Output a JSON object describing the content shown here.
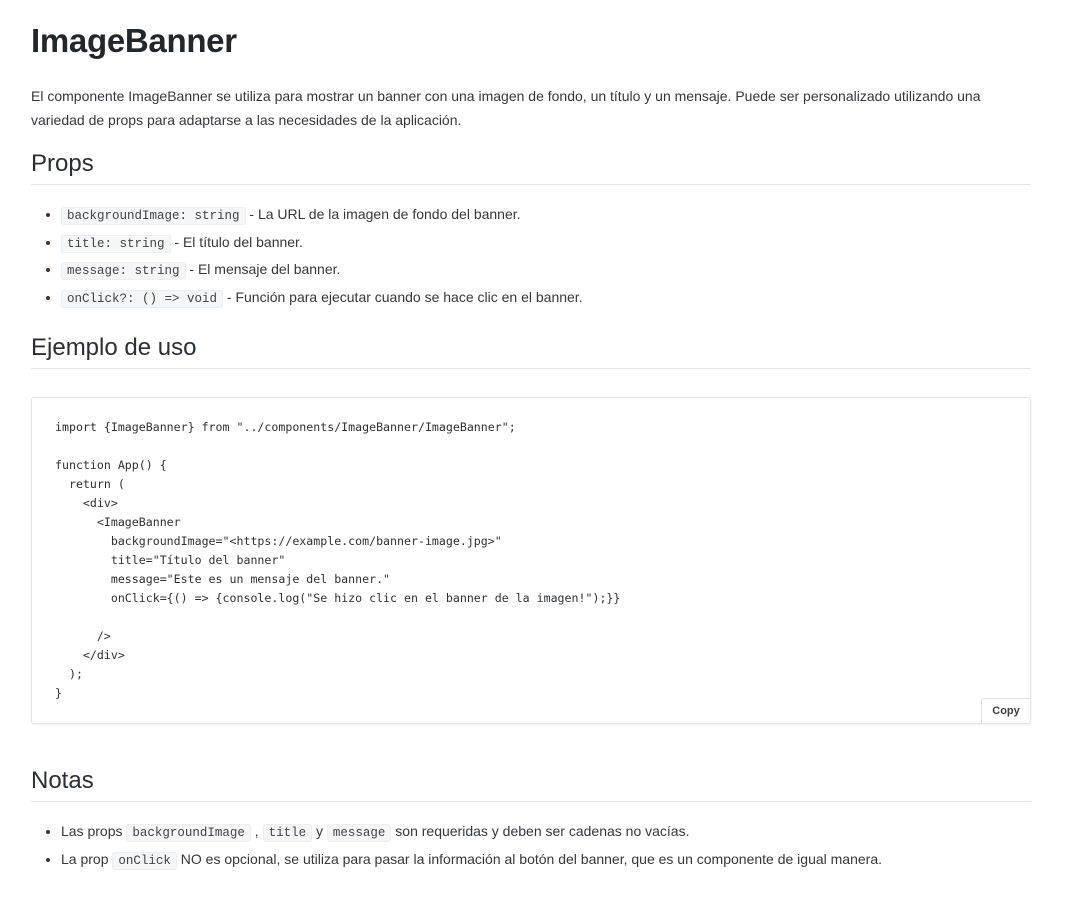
{
  "page": {
    "title": "ImageBanner",
    "intro": "El componente ImageBanner se utiliza para mostrar un banner con una imagen de fondo, un título y un mensaje. Puede ser personalizado utilizando una variedad de props para adaptarse a las necesidades de la aplicación."
  },
  "props_section": {
    "heading": "Props",
    "items": [
      {
        "code": "backgroundImage: string",
        "text": " - La URL de la imagen de fondo del banner."
      },
      {
        "code": "title: string",
        "text": " - El título del banner."
      },
      {
        "code": "message: string",
        "text": " - El mensaje del banner."
      },
      {
        "code": "onClick?: () => void",
        "text": " - Función para ejecutar cuando se hace clic en el banner."
      }
    ]
  },
  "example_section": {
    "heading": "Ejemplo de uso",
    "code": "import {ImageBanner} from \"../components/ImageBanner/ImageBanner\";\n\nfunction App() {\n  return (\n    <div>\n      <ImageBanner\n        backgroundImage=\"<https://example.com/banner-image.jpg>\"\n        title=\"Título del banner\"\n        message=\"Este es un mensaje del banner.\"\n        onClick={() => {console.log(\"Se hizo clic en el banner de la imagen!\");}}\n\n      />\n    </div>\n  );\n}",
    "copy_label": "Copy"
  },
  "notes_section": {
    "heading": "Notas",
    "note1": {
      "prefix": "Las props ",
      "code1": "backgroundImage",
      "sep1": " , ",
      "code2": "title",
      "sep2": " y ",
      "code3": "message",
      "suffix": " son requeridas y deben ser cadenas no vacías."
    },
    "note2": {
      "prefix": "La prop ",
      "code1": "onClick",
      "suffix": " NO es opcional, se utiliza para pasar la información al botón del banner, que es un componente de igual manera."
    }
  }
}
